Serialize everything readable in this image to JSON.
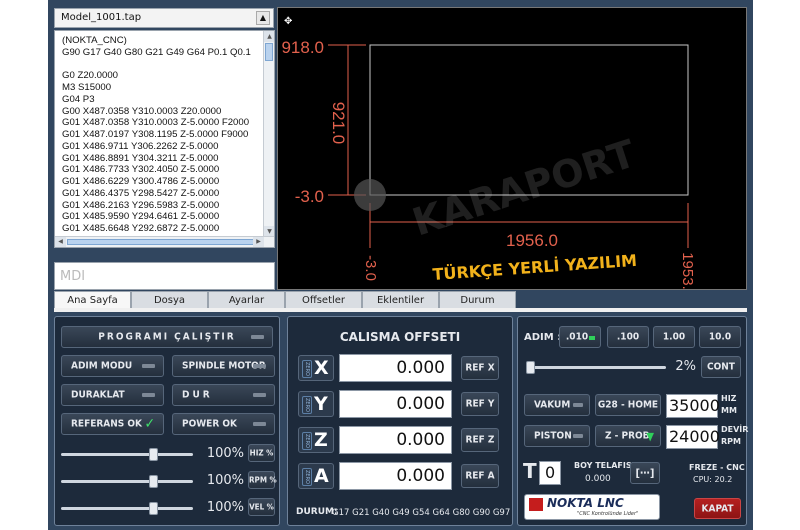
{
  "file": {
    "name": "Model_1001.tap"
  },
  "gcode_lines": [
    "(NOKTA_CNC)",
    "G90 G17 G40 G80 G21 G49 G64 P0.1 Q0.1",
    "",
    "G0 Z20.0000",
    "M3 S15000",
    "G04 P3",
    "G00 X487.0358 Y310.0003 Z20.0000",
    "G01 X487.0358 Y310.0003 Z-5.0000 F2000",
    "G01 X487.0197 Y308.1195 Z-5.0000 F9000",
    "G01 X486.9711 Y306.2262 Z-5.0000",
    "G01 X486.8891 Y304.3211 Z-5.0000",
    "G01 X486.7733 Y302.4050 Z-5.0000",
    "G01 X486.6229 Y300.4786 Z-5.0000",
    "G01 X486.4375 Y298.5427 Z-5.0000",
    "G01 X486.2163 Y296.5983 Z-5.0000",
    "G01 X485.9590 Y294.6461 Z-5.0000",
    "G01 X485.6648 Y292.6872 Z-5.0000",
    "G01 X485.3334 Y290.7224 Z-5.0000"
  ],
  "mdi": {
    "placeholder": "MDI"
  },
  "viewport": {
    "dim_top": "918.0",
    "dim_left": "921.0",
    "dim_low": "-3.0",
    "dim_bottom": "1956.0",
    "dim_bottom_left": "-3.0",
    "dim_bottom_right": "1953.",
    "banner": "TÜRKÇE YERLİ YAZILIM",
    "watermark": "KARAPORT",
    "line_color": "#c8c8c8",
    "dim_color": "#e2614d",
    "banner_color": "#f2b21b"
  },
  "tabs": [
    "Ana Sayfa",
    "Dosya",
    "Ayarlar",
    "Offsetler",
    "Eklentiler",
    "Durum"
  ],
  "left_panel": {
    "run": "PROGRAMI ÇALIŞTIR",
    "step_mode": "ADIM MODU",
    "spindle_motor": "SPINDLE MOTOR",
    "pause": "DURAKLAT",
    "stop": "DUR",
    "reference_ok": "REFERANS OK",
    "power_ok": "POWER OK",
    "check_glyph": "✓",
    "sliders": [
      {
        "pct": "100%",
        "tag": "HIZ %",
        "value": 1.0
      },
      {
        "pct": "100%",
        "tag": "RPM %",
        "value": 1.0
      },
      {
        "pct": "100%",
        "tag": "VEL %",
        "value": 1.0
      }
    ]
  },
  "offset_panel": {
    "title": "CALISMA OFFSETI",
    "zero_tag": "ZERO",
    "axes": [
      {
        "letter": "X",
        "value": "0.000",
        "ref": "REF X"
      },
      {
        "letter": "Y",
        "value": "0.000",
        "ref": "REF Y"
      },
      {
        "letter": "Z",
        "value": "0.000",
        "ref": "REF Z"
      },
      {
        "letter": "A",
        "value": "0.000",
        "ref": "REF A"
      }
    ],
    "status_label": "DURUM:",
    "status_value": "G17 G21 G40 G49 G54 G64 G80 G90 G97"
  },
  "right_panel": {
    "step_label": "ADIM :",
    "steps": [
      ".010",
      ".100",
      "1.00",
      "10.0"
    ],
    "jog_pct": "2%",
    "jog_value": 0.02,
    "cont": "CONT",
    "vacuum": "VAKUM",
    "g28": "G28 - HOME",
    "speed_value": "35000.",
    "speed_unit_1": "HIZ",
    "speed_unit_2": "MM",
    "piston": "PISTON",
    "zprob": "Z - PROB",
    "rpm_value": "24000",
    "rpm_unit_1": "DEVİR",
    "rpm_unit_2": "RPM",
    "tool_letter": "T",
    "tool_value": "0",
    "length_label": "BOY TELAFISI",
    "length_value": "0.000",
    "machine": "FREZE - CNC",
    "cpu": "CPU: 20.2",
    "logo_text": "NOKTA LNC",
    "logo_sub": "\"CNC Kontrolünde Lider\"",
    "close": "KAPAT",
    "close_color": "#a01818",
    "zprob_arrow_color": "#2fd05a"
  }
}
